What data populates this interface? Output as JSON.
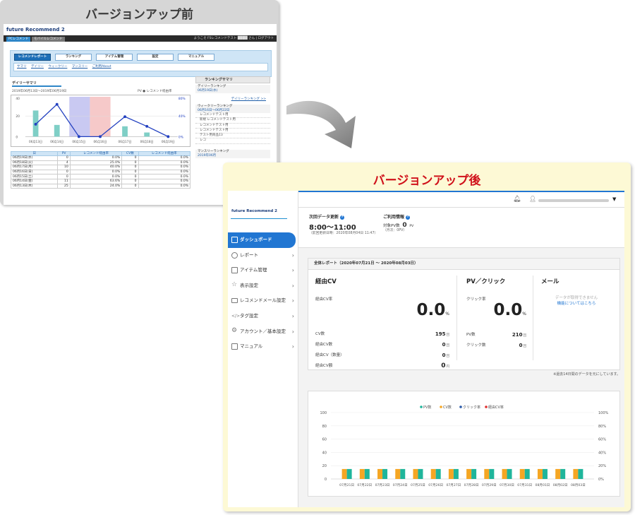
{
  "before": {
    "title": "バージョンアップ前",
    "app_title": "future Recommend 2",
    "tabs": [
      "PCレコメンド",
      "モバイルレコメンド"
    ],
    "user_text": "ようこそ FSレコメンドテスト ████ さん | ログアウト",
    "nav": [
      "レコメンドレポート",
      "ランキング",
      "アイテム管理",
      "設定",
      "マニュアル"
    ],
    "subnav": [
      "サマリ",
      "デイリー",
      "ウィークリー",
      "マンスリー",
      "ご利用About"
    ],
    "section_title": "デイリーサマリ",
    "date_range": "2019年06月13日〜2019年06月19日",
    "legend": "PV ● レコメンド経由率",
    "chart_x": [
      "06月13日",
      "06月14日",
      "06月15日",
      "06月16日",
      "06月17日",
      "06月18日",
      "06月19日"
    ],
    "chart_y_left": [
      "40",
      "20",
      "0"
    ],
    "chart_y_right": [
      "80%",
      "40%",
      "0%"
    ],
    "table_headers": [
      "日",
      "PV",
      "レコメンド経由率",
      "CV数",
      "レコメンド経由率"
    ],
    "table_rows": [
      [
        "06月19日(水)",
        "0",
        "0.0%",
        "0",
        "0.0%"
      ],
      [
        "06月18日(火)",
        "4",
        "25.0%",
        "0",
        "0.0%"
      ],
      [
        "06月17日(月)",
        "10",
        "40.0%",
        "0",
        "0.0%"
      ],
      [
        "06月16日(日)",
        "0",
        "0.0%",
        "0",
        "0.0%"
      ],
      [
        "06月15日(土)",
        "0",
        "0.0%",
        "0",
        "0.0%"
      ],
      [
        "06月14日(金)",
        "11",
        "63.6%",
        "0",
        "0.0%"
      ],
      [
        "06月13日(木)",
        "25",
        "24.0%",
        "0",
        "0.0%"
      ]
    ],
    "ranking_title": "ランキングサマリ",
    "daily_rank_title": "デイリーランキング",
    "daily_rank_date": "06月19日(水)",
    "daily_rank_link": "デイリーランキング >>",
    "weekly_rank_title": "ウィークリーランキング",
    "weekly_rank_date": "06月16日〜06月22日",
    "weekly_items": [
      "レコメンドテスト用",
      "新規 レコメンドテスト用",
      "レコメンドテスト用",
      "レコメンドテスト用",
      "テスト用商品13",
      "レコ"
    ],
    "monthly_rank_title": "マンスリーランキング",
    "monthly_rank_date": "2019年06月"
  },
  "after": {
    "title": "バージョンアップ後",
    "app_title": "future Recommend 2",
    "menu": [
      {
        "label": "ダッシュボード",
        "icon": "dashboard-icon",
        "active": true
      },
      {
        "label": "レポート",
        "icon": "pie-chart-icon"
      },
      {
        "label": "アイテム管理",
        "icon": "clipboard-icon"
      },
      {
        "label": "表示設定",
        "icon": "star-icon"
      },
      {
        "label": "レコメンドメール設定",
        "icon": "mail-icon"
      },
      {
        "label": "タグ設定",
        "icon": "code-icon"
      },
      {
        "label": "アカウント／基本設定",
        "icon": "gear-icon"
      },
      {
        "label": "マニュアル",
        "icon": "book-icon"
      }
    ],
    "next_update_label": "次回データ更新",
    "next_update_time": "8:00〜11:00",
    "last_update_text": "（前回更新日時：2020年08月04日 11:47）",
    "usage_label": "ご利用情報",
    "target_pv_label": "対象PV数",
    "target_pv_value": "0",
    "target_pv_unit": "PV",
    "target_pv_note": "（月次：0PV）",
    "report_header": "全体レポート（2020年07月21日 ～ 2020年08月03日）",
    "cv_title": "経由CV",
    "cv_rate_label": "経由CV率",
    "cv_rate_value": "0.0",
    "percent": "%",
    "cv_count_label": "CV数",
    "cv_count_value": "195",
    "via_cv_label": "経由CV数",
    "via_cv_value": "0",
    "via_cv_qty_label": "経由CV（数量）",
    "via_cv_qty_value": "0",
    "via_cv_amount_label": "経由CV額",
    "via_cv_amount_value": "0",
    "unit_count": "回",
    "unit_yen": "円",
    "pv_title": "PV／クリック",
    "click_rate_label": "クリック率",
    "click_rate_value": "0.0",
    "pv_count_label": "PV数",
    "pv_count_value": "210",
    "click_count_label": "クリック数",
    "click_count_value": "0",
    "mail_title": "メール",
    "mail_msg": "データが取得できません",
    "mail_link": "機能についてはこちら",
    "footnote": "※過去14日間のデータを元にしています。"
  },
  "chart_data": {
    "type": "bar",
    "categories": [
      "07月21日",
      "07月22日",
      "07月23日",
      "07月24日",
      "07月25日",
      "07月26日",
      "07月27日",
      "07月28日",
      "07月29日",
      "07月30日",
      "07月31日",
      "08月01日",
      "08月02日",
      "08月03日"
    ],
    "series": [
      {
        "name": "PV数",
        "color": "#1fb59b",
        "axis": "left",
        "values": [
          15,
          15,
          15,
          15,
          15,
          15,
          15,
          15,
          15,
          15,
          15,
          15,
          15,
          15
        ]
      },
      {
        "name": "CV数",
        "color": "#f5a623",
        "axis": "left",
        "values": [
          15,
          15,
          15,
          15,
          15,
          15,
          15,
          15,
          15,
          15,
          15,
          15,
          15,
          15
        ]
      },
      {
        "name": "クリック率",
        "color": "#2a5aa8",
        "axis": "right",
        "values": [
          0,
          0,
          0,
          0,
          0,
          0,
          0,
          0,
          0,
          0,
          0,
          0,
          0,
          0
        ]
      },
      {
        "name": "経由CV率",
        "color": "#e02f2f",
        "axis": "right",
        "values": [
          0,
          0,
          0,
          0,
          0,
          0,
          0,
          0,
          0,
          0,
          0,
          0,
          0,
          0
        ]
      }
    ],
    "ylim": [
      0,
      100
    ],
    "y2lim": [
      0,
      100
    ],
    "y_ticks": [
      "0",
      "20",
      "40",
      "60",
      "80",
      "100"
    ],
    "y2_ticks": [
      "0%",
      "20%",
      "40%",
      "60%",
      "80%",
      "100%"
    ],
    "grid": true,
    "legend_position": "top"
  }
}
